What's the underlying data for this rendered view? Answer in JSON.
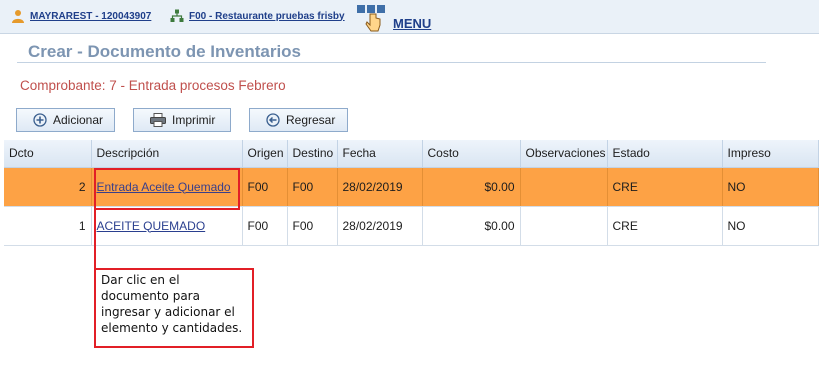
{
  "topbar": {
    "user": "MAYRAREST - 120043907",
    "site": "F00 - Restaurante pruebas frisby",
    "menu": "MENU",
    "icons": [
      "user-icon",
      "network-icon",
      "menu-cursor-icon"
    ]
  },
  "page": {
    "title": "Crear - Documento de Inventarios",
    "comprobante": "Comprobante: 7 - Entrada procesos Febrero"
  },
  "toolbar": {
    "add_label": "Adicionar",
    "print_label": "Imprimir",
    "back_label": "Regresar"
  },
  "table": {
    "headers": {
      "dcto": "Dcto",
      "descripcion": "Descripción",
      "origen": "Origen",
      "destino": "Destino",
      "fecha": "Fecha",
      "costo": "Costo",
      "observaciones": "Observaciones",
      "estado": "Estado",
      "impreso": "Impreso"
    },
    "rows": [
      {
        "dcto": "2",
        "descripcion": "Entrada Aceite Quemado",
        "origen": "F00",
        "destino": "F00",
        "fecha": "28/02/2019",
        "costo": "$0.00",
        "observaciones": "",
        "estado": "CRE",
        "impreso": "NO",
        "selected": true
      },
      {
        "dcto": "1",
        "descripcion": "ACEITE QUEMADO",
        "origen": "F00",
        "destino": "F00",
        "fecha": "28/02/2019",
        "costo": "$0.00",
        "observaciones": "",
        "estado": "CRE",
        "impreso": "NO",
        "selected": false
      }
    ]
  },
  "annotation": {
    "text": "Dar clic en el documento para ingresar y adicionar el elemento y cantidades."
  },
  "colors": {
    "selected_row": "#fda245",
    "highlight": "#e21f26",
    "title": "#7d95b2",
    "comprobante": "#c0504d"
  }
}
